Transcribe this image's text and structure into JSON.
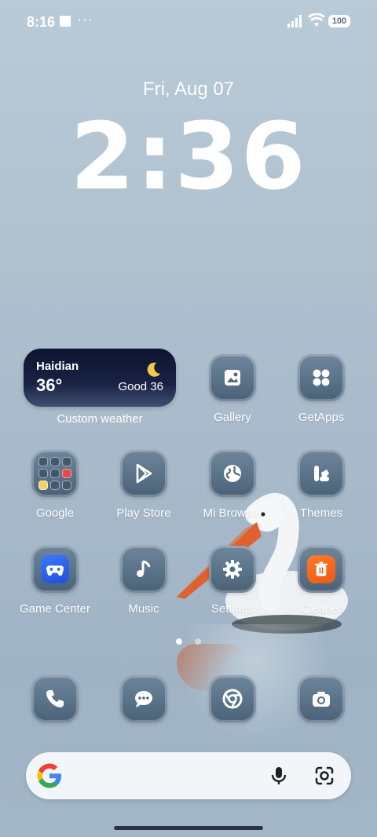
{
  "status_bar": {
    "time": "8:16",
    "more": "···",
    "battery": "100"
  },
  "lockclock": {
    "date": "Fri, Aug 07",
    "time": "2:36"
  },
  "weather_widget": {
    "city": "Haidian",
    "temperature": "36°",
    "aqi": "Good 36",
    "label": "Custom weather"
  },
  "apps": {
    "gallery": "Gallery",
    "getapps": "GetApps",
    "google": "Google",
    "play_store": "Play Store",
    "mi_browser": "Mi Browser",
    "themes": "Themes",
    "game_center": "Game Center",
    "music": "Music",
    "settings": "Settings",
    "cleaner": "Cleaner"
  },
  "dock": [
    "phone-icon",
    "messages-icon",
    "chrome-icon",
    "camera-icon"
  ],
  "search_bar": {
    "placeholder": ""
  }
}
